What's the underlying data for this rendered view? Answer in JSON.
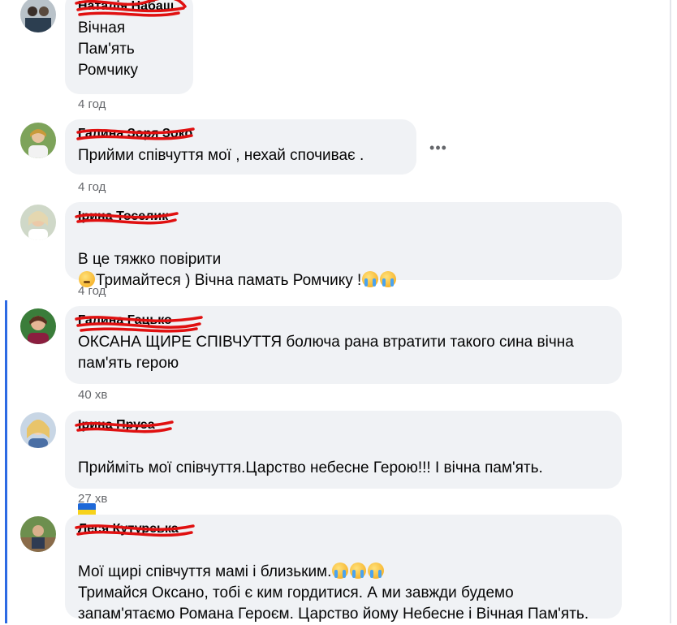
{
  "comments": [
    {
      "author": "Наталія Набаш",
      "text": "Вічная\nПам'ять\nРомчику",
      "time": "4 год"
    },
    {
      "author": "Галина Зоря Зоко",
      "text": "Прийми співчуття мої , нехай спочиває .",
      "time": "4 год",
      "more_label": "•••"
    },
    {
      "author": "Ірина Тоселик",
      "text_1": "В це тяжко повірити",
      "text_2": "Тримайтеся ) Вічна памать Ромчику !",
      "time": "4 год"
    },
    {
      "author": "Галина Гацько",
      "text": "ОКСАНА ЩИРЕ СПІВЧУТТЯ болюча рана втратити такого сина вічна пам'ять герою",
      "time": "40 хв"
    },
    {
      "author": "Ірина Пруса",
      "text": "Прийміть мої співчуття.Царство небесне Герою!!! І вічна пам'ять.",
      "time": "27 хв"
    },
    {
      "author": "Леся Кутурська",
      "text_1": "Мої щирі співчуття мамі і близьким.",
      "text_2": "Тримайся Оксано, тобі є ким гордитися. А ми завжди будемо запам'ятаємо Романа Героєм. Царство йому Небесне і Вічная Пам'ять."
    }
  ],
  "icons": {
    "emoji_cry": "loudly-crying-face-icon",
    "emoji_sleepy": "sleepy-face-icon",
    "flag": "ukraine-flag-icon",
    "more": "more-options-icon"
  },
  "colors": {
    "bubble": "#f0f2f5",
    "meta_text": "#65676b",
    "redaction": "#e01010",
    "thread_line": "#2d6ae3"
  }
}
